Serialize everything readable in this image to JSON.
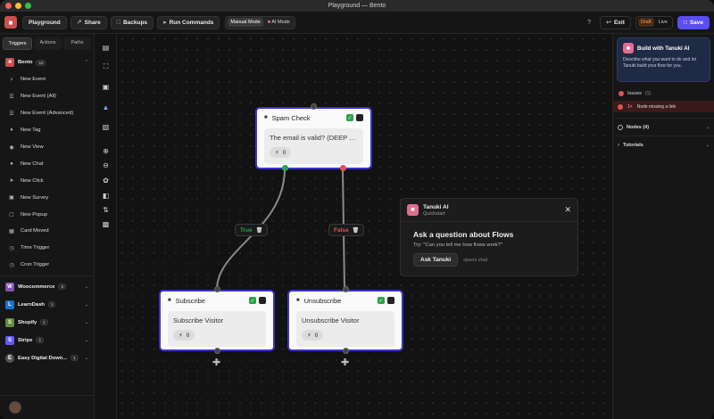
{
  "window": {
    "title": "Playground — Bento"
  },
  "toolbar": {
    "playground": "Playground",
    "share": "Share",
    "backups": "Backups",
    "run_commands": "Run Commands",
    "manual_mode": "Manual Mode",
    "ai_mode": "AI Mode",
    "help": "?",
    "exit": "Exit",
    "draft": "Draft",
    "live": "Live",
    "save": "Save"
  },
  "left_panel": {
    "tabs": [
      {
        "label": "Triggers"
      },
      {
        "label": "Actions"
      },
      {
        "label": "Paths"
      }
    ],
    "bento": {
      "label": "Bento",
      "count": "12",
      "items": [
        {
          "label": "New Event"
        },
        {
          "label": "New Event (All)"
        },
        {
          "label": "New Event (Advanced)"
        },
        {
          "label": "New Tag"
        },
        {
          "label": "New View"
        },
        {
          "label": "New Chat"
        },
        {
          "label": "New Click"
        },
        {
          "label": "New Survey"
        },
        {
          "label": "New Popup"
        },
        {
          "label": "Card Moved"
        },
        {
          "label": "Time Trigger"
        },
        {
          "label": "Cron Trigger"
        }
      ]
    },
    "integrations": [
      {
        "label": "Woocommerce",
        "count": "2",
        "color": "#7f54b3",
        "glyph": "W"
      },
      {
        "label": "LearnDash",
        "count": "1",
        "color": "#1a73c8",
        "glyph": "L"
      },
      {
        "label": "Shopify",
        "count": "1",
        "color": "#5e8e3e",
        "glyph": "S"
      },
      {
        "label": "Stripe",
        "count": "1",
        "color": "#635bff",
        "glyph": "S"
      },
      {
        "label": "Easy Digital Down...",
        "count": "1",
        "color": "#555555",
        "glyph": "E"
      }
    ]
  },
  "nodes": {
    "spam": {
      "title": "Spam Check",
      "body": "The email is valid? (DEEP CH...",
      "count": "0"
    },
    "subscribe": {
      "title": "Subscribe",
      "body": "Subscribe Visitor",
      "count": "0"
    },
    "unsubscribe": {
      "title": "Unsubscribe",
      "body": "Unsubscribe Visitor",
      "count": "0"
    }
  },
  "edges": {
    "true_label": "True",
    "false_label": "False",
    "true_color": "#2aa34a",
    "false_color": "#e05454"
  },
  "tanuki_popup": {
    "title": "Tanuki AI",
    "subtitle": "Quickstart",
    "question": "Ask a question about Flows",
    "try": "Try: \"Can you tell me how flows work?\"",
    "ask_button": "Ask Tanuki",
    "opens": "opens chat"
  },
  "right_panel": {
    "ai_card": {
      "title": "Build with Tanuki AI",
      "desc": "Describe what you want to do and let Tanuki build your flow for you."
    },
    "issues": {
      "label": "Issues",
      "count": "(1)"
    },
    "issue_row": {
      "count": "1×",
      "text": "Node missing a link"
    },
    "nodes": {
      "label": "Nodes (4)"
    },
    "tutorials": {
      "label": "Tutorials"
    }
  },
  "colors": {
    "accent": "#5b4ef0",
    "node_border": "#3d33c9",
    "brand": "#c8504e"
  }
}
